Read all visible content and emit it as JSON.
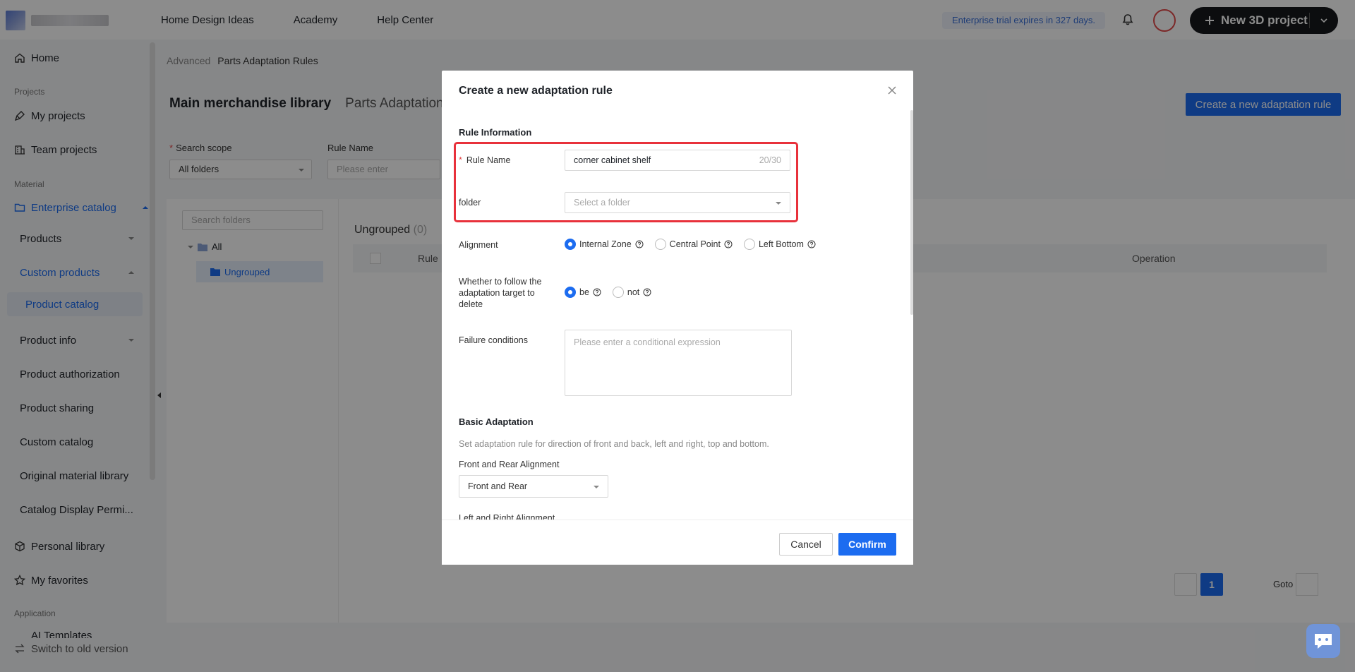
{
  "topbar": {
    "nav": [
      "Home Design Ideas",
      "Academy",
      "Help Center"
    ],
    "trial_text": "Enterprise trial expires in 327 days.",
    "new_project_label": "New 3D project"
  },
  "sidebar": {
    "home": "Home",
    "group_projects": "Projects",
    "my_projects": "My projects",
    "team_projects": "Team projects",
    "group_material": "Material",
    "enterprise_catalog": "Enterprise catalog",
    "products": "Products",
    "custom_products": "Custom products",
    "product_catalog": "Product catalog",
    "product_info": "Product info",
    "product_authorization": "Product authorization",
    "product_sharing": "Product sharing",
    "custom_catalog": "Custom catalog",
    "original_material_library": "Original material library",
    "catalog_display": "Catalog Display Permi...",
    "personal_library": "Personal library",
    "my_favorites": "My favorites",
    "group_application": "Application",
    "ai_templates": "AI Templates",
    "switch_old": "Switch to old version"
  },
  "main": {
    "breadcrumb": [
      "Advanced",
      "Parts Adaptation Rules"
    ],
    "tabs": [
      "Main merchandise library",
      "Parts Adaptation"
    ],
    "create_button": "Create a new adaptation rule",
    "filters": {
      "scope_label": "Search scope",
      "scope_value": "All folders",
      "rule_name_label": "Rule Name",
      "rule_name_placeholder": "Please enter"
    },
    "tree": {
      "search_placeholder": "Search folders",
      "all": "All",
      "ungrouped": "Ungrouped"
    },
    "group_title": "Ungrouped",
    "group_count": "(0)",
    "table_headers": [
      "Rule",
      "Operation"
    ],
    "pagination": {
      "current": "1",
      "goto": "Goto"
    }
  },
  "modal": {
    "title": "Create a new adaptation rule",
    "section_rule_info": "Rule Information",
    "rule_name_label": "Rule Name",
    "rule_name_value": "corner cabinet shelf",
    "rule_name_count": "20/30",
    "folder_label": "folder",
    "folder_placeholder": "Select a folder",
    "alignment_label": "Alignment",
    "alignment_options": [
      "Internal Zone",
      "Central Point",
      "Left Bottom"
    ],
    "alignment_selected": "Internal Zone",
    "follow_label": "Whether to follow the adaptation target to delete",
    "follow_options": [
      "be",
      "not"
    ],
    "follow_selected": "be",
    "failure_label": "Failure conditions",
    "failure_placeholder": "Please enter a conditional expression",
    "section_basic": "Basic Adaptation",
    "basic_hint": "Set adaptation rule for direction of front and back, left and right, top and bottom.",
    "front_rear_label": "Front and Rear Alignment",
    "front_rear_value": "Front and Rear",
    "left_right_label": "Left and Right Alignment",
    "cancel": "Cancel",
    "confirm": "Confirm"
  }
}
